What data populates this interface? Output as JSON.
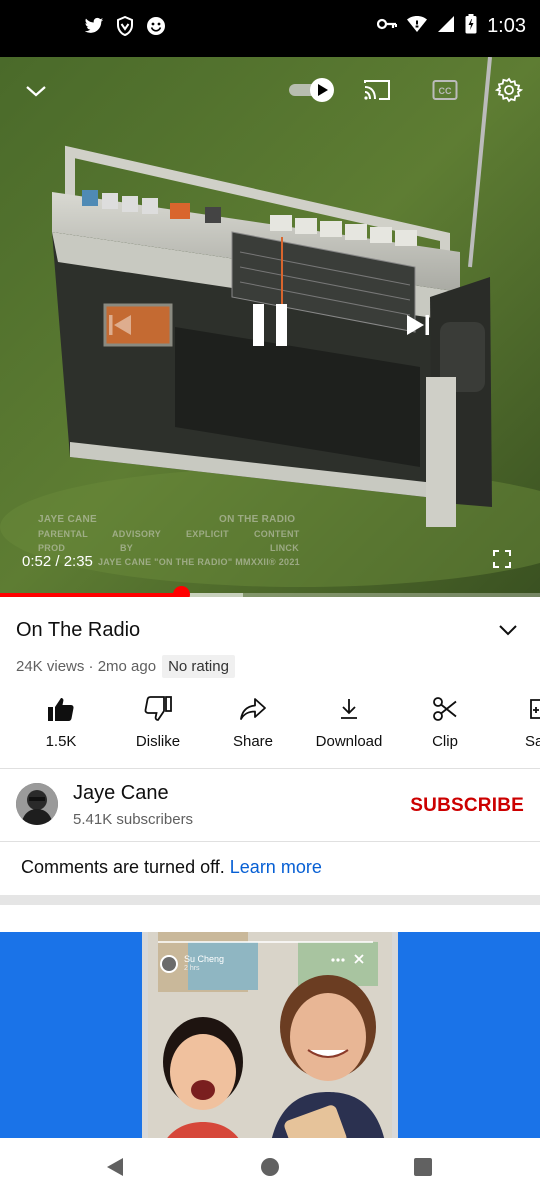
{
  "status_bar": {
    "time": "1:03",
    "left_icons": [
      "twitter-icon",
      "shield-icon",
      "smiley-icon"
    ],
    "right_icons": [
      "key-icon",
      "wifi-icon",
      "signal-icon",
      "battery-icon"
    ]
  },
  "player": {
    "time_current": "0:52",
    "time_total": "2:35",
    "time_display": "0:52 / 2:35",
    "progress_fraction": 0.335,
    "buffered_fraction": 0.45,
    "autoplay_on": true,
    "album_cover": {
      "artist": "JAYE CANE",
      "title": "ON THE RADIO",
      "advisory_row": [
        "PARENTAL",
        "ADVISORY",
        "EXPLICIT",
        "CONTENT"
      ],
      "prod_row": [
        "PROD",
        "BY",
        "LINCK"
      ],
      "copyright": "JAYE CANE \"ON THE RADIO\" MMXXII® 2021"
    }
  },
  "video": {
    "title": "On The Radio",
    "views": "24K views",
    "age": "2mo ago",
    "meta": "24K views · 2mo ago",
    "rating_label": "No rating"
  },
  "actions": [
    {
      "label": "1.5K",
      "icon": "like-icon"
    },
    {
      "label": "Dislike",
      "icon": "dislike-icon"
    },
    {
      "label": "Share",
      "icon": "share-icon"
    },
    {
      "label": "Download",
      "icon": "download-icon"
    },
    {
      "label": "Clip",
      "icon": "scissors-icon"
    },
    {
      "label": "Sa",
      "icon": "save-icon"
    }
  ],
  "channel": {
    "name": "Jaye Cane",
    "subscribers": "5.41K subscribers",
    "subscribe_label": "SUBSCRIBE"
  },
  "comments": {
    "text": "Comments are turned off.",
    "link": "Learn more"
  },
  "ad": {
    "story_user": "Su Cheng",
    "story_time": "2 hrs"
  },
  "colors": {
    "accent_red": "#ff0000",
    "subscribe_red": "#cc0000",
    "link_blue": "#065fd4",
    "ad_blue": "#1a73e8"
  }
}
